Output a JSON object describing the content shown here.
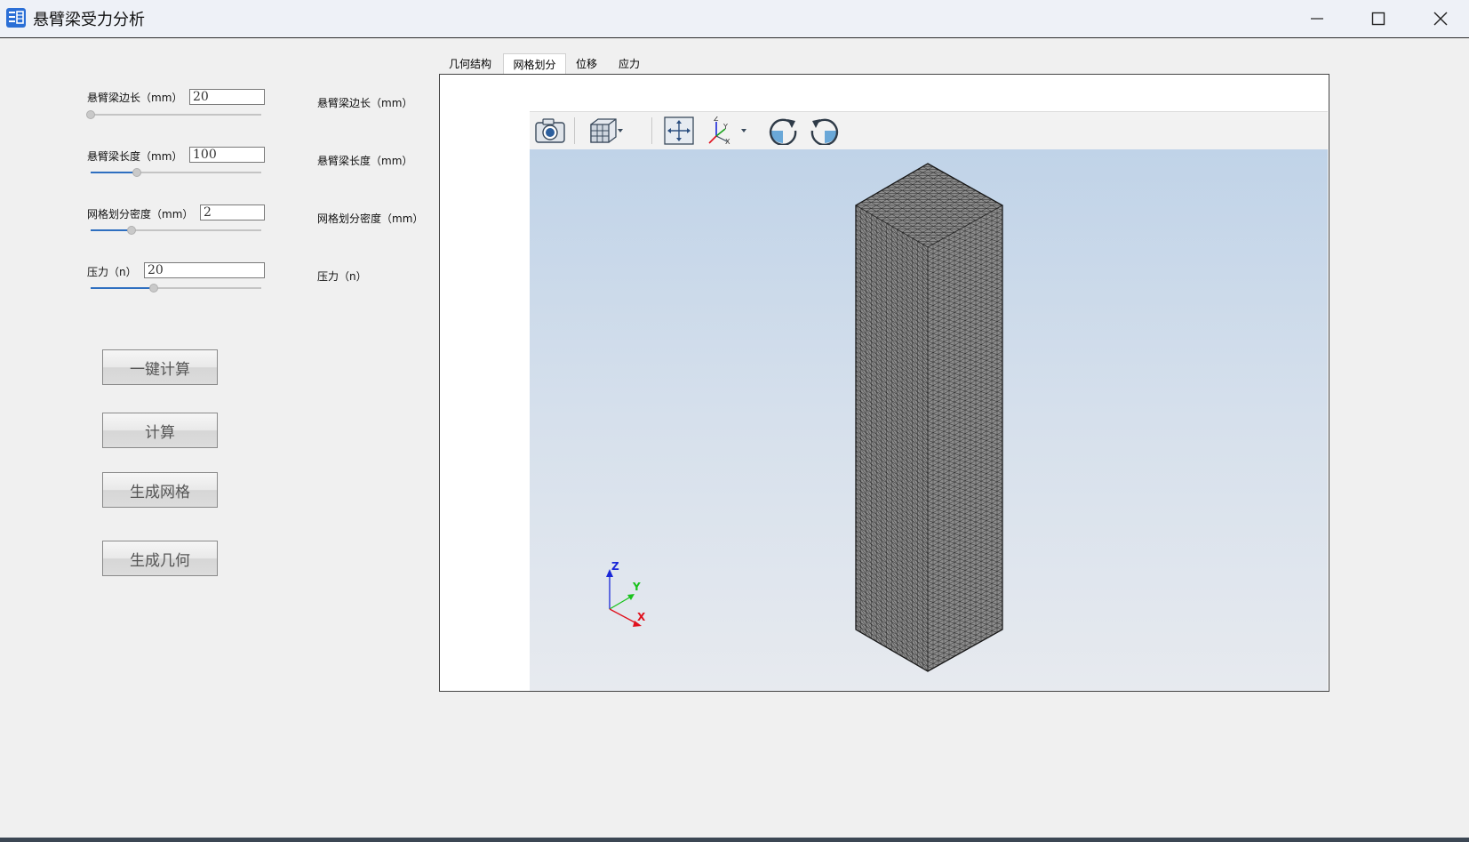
{
  "window": {
    "title": "悬臂梁受力分析",
    "icons": [
      "app-icon",
      "minimize-icon",
      "maximize-icon",
      "close-icon"
    ]
  },
  "params": [
    {
      "label": "悬臂梁边长（mm）",
      "value": "20",
      "slider_fraction": 0.0
    },
    {
      "label": "悬臂梁长度（mm）",
      "value": "100",
      "slider_fraction": 0.27
    },
    {
      "label": "网格划分密度（mm）",
      "value": "2",
      "slider_fraction": 0.24
    },
    {
      "label": "压力（n）",
      "value": "20",
      "slider_fraction": 0.37
    }
  ],
  "result_labels": [
    "悬臂梁边长（mm）",
    "悬臂梁长度（mm）",
    "网格划分密度（mm）",
    "压力（n）"
  ],
  "buttons": {
    "one_click": "一键计算",
    "compute": "计算",
    "gen_mesh": "生成网格",
    "gen_geom": "生成几何"
  },
  "tabs": [
    {
      "label": "几何结构",
      "active": false
    },
    {
      "label": "网格划分",
      "active": true
    },
    {
      "label": "位移",
      "active": false
    },
    {
      "label": "应力",
      "active": false
    }
  ],
  "toolbar": {
    "icons": [
      "camera-icon",
      "view-cube-icon",
      "fit-view-icon",
      "axes-orientation-icon",
      "rotate-cw-icon",
      "rotate-ccw-icon"
    ]
  },
  "triad": {
    "x": "X",
    "y": "Y",
    "z": "Z"
  },
  "colors": {
    "accent": "#2e6fc0",
    "mesh_face": "#8c8c8c",
    "mesh_line": "#2a2a2a",
    "axis_x": "#e0121e",
    "axis_y": "#19c21c",
    "axis_z": "#1a28d8"
  }
}
